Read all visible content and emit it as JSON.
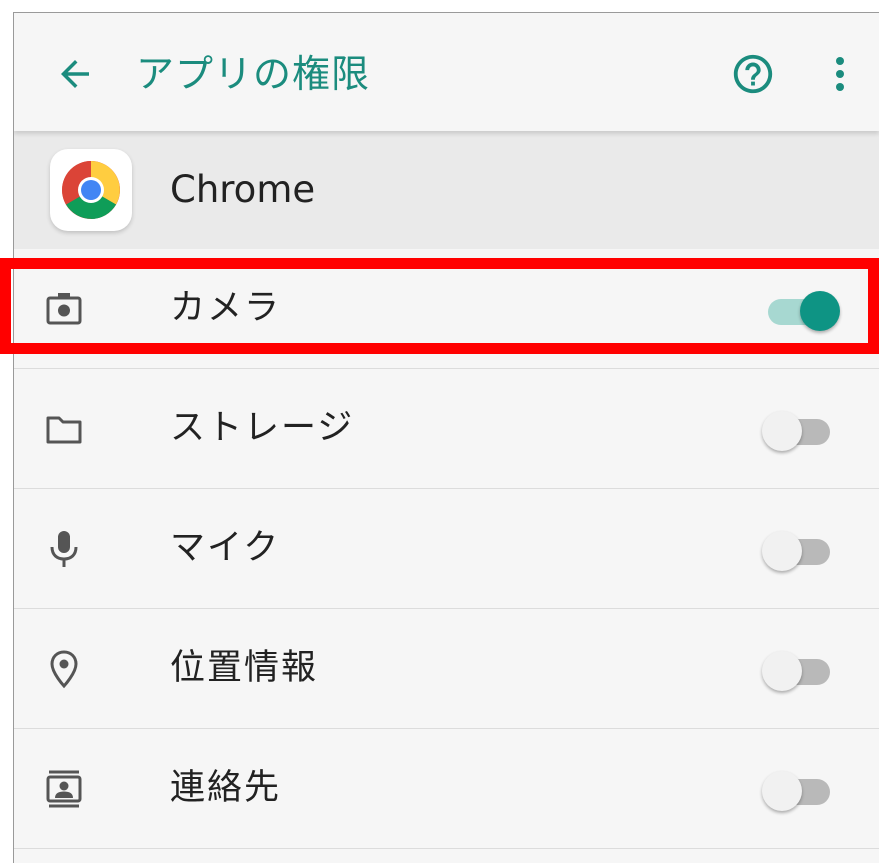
{
  "toolbar": {
    "title": "アプリの権限",
    "back_icon": "arrow-back-icon",
    "help_icon": "help-circle-icon",
    "more_icon": "more-vert-icon"
  },
  "app": {
    "name": "Chrome",
    "icon": "chrome-icon"
  },
  "permissions": [
    {
      "label": "カメラ",
      "icon": "camera-icon",
      "enabled": true
    },
    {
      "label": "ストレージ",
      "icon": "folder-icon",
      "enabled": false
    },
    {
      "label": "マイク",
      "icon": "mic-icon",
      "enabled": false
    },
    {
      "label": "位置情報",
      "icon": "location-icon",
      "enabled": false
    },
    {
      "label": "連絡先",
      "icon": "contacts-icon",
      "enabled": false
    }
  ],
  "colors": {
    "accent": "#1b8c7e",
    "toggle_on_thumb": "#0e9484",
    "toggle_on_track": "#a7d8d1",
    "toggle_off_thumb": "#f1f1f1",
    "toggle_off_track": "#b9b9b9",
    "highlight": "#ff0000"
  }
}
